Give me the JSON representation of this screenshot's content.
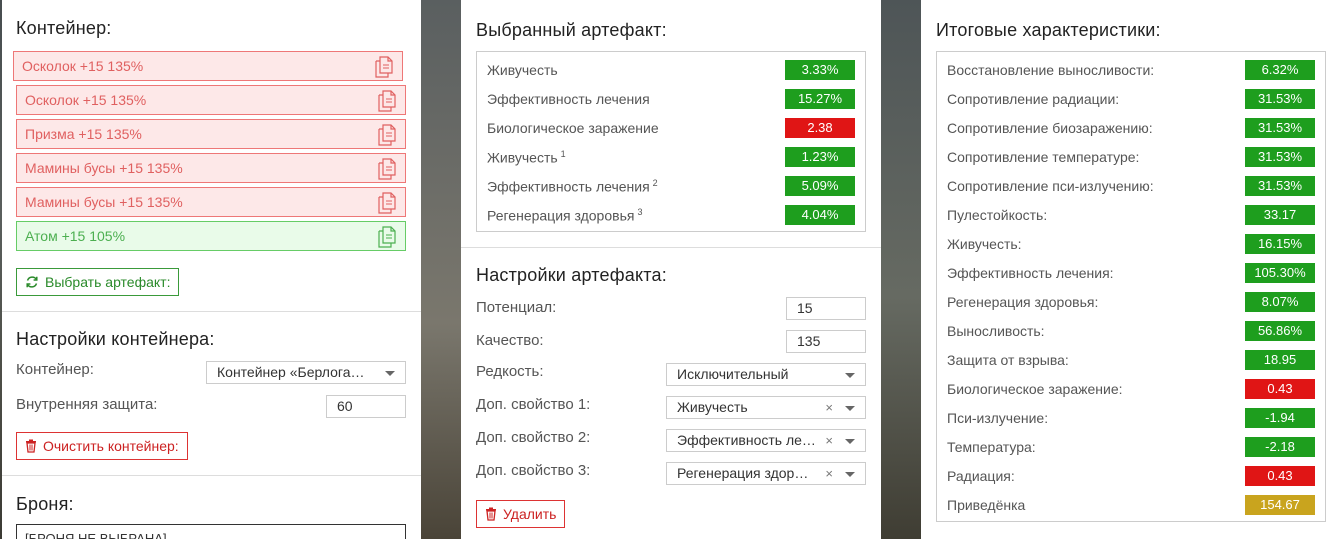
{
  "container_panel": {
    "title": "Контейнер:",
    "items": [
      {
        "label": "Осколок +15 135%",
        "state": "red"
      },
      {
        "label": "Осколок +15 135%",
        "state": "red"
      },
      {
        "label": "Призма +15 135%",
        "state": "red"
      },
      {
        "label": "Мамины бусы +15 135%",
        "state": "red"
      },
      {
        "label": "Мамины бусы +15 135%",
        "state": "red"
      },
      {
        "label": "Атом +15 105%",
        "state": "green"
      }
    ],
    "select_button": "Выбрать артефакт:"
  },
  "container_settings": {
    "title": "Настройки контейнера:",
    "container_label": "Контейнер:",
    "container_value": "Контейнер «Берлога…",
    "inner_protection_label": "Внутренняя защита:",
    "inner_protection_value": "60",
    "clear_button": "Очистить контейнер:"
  },
  "armor": {
    "title": "Броня:",
    "value": "[БРОНЯ НЕ ВЫБРАНА]"
  },
  "selected_artifact": {
    "title": "Выбранный артефакт:",
    "stats": [
      {
        "name": "Живучесть",
        "sup": "",
        "value": "3.33%",
        "color": "green"
      },
      {
        "name": "Эффективность лечения",
        "sup": "",
        "value": "15.27%",
        "color": "green"
      },
      {
        "name": "Биологическое заражение",
        "sup": "",
        "value": "2.38",
        "color": "red"
      },
      {
        "name": "Живучесть",
        "sup": "1",
        "value": "1.23%",
        "color": "green"
      },
      {
        "name": "Эффективность лечения",
        "sup": "2",
        "value": "5.09%",
        "color": "green"
      },
      {
        "name": "Регенерация здоровья",
        "sup": "3",
        "value": "4.04%",
        "color": "green"
      }
    ]
  },
  "artifact_settings": {
    "title": "Настройки артефакта:",
    "potential_label": "Потенциал:",
    "potential_value": "15",
    "quality_label": "Качество:",
    "quality_value": "135",
    "rarity_label": "Редкость:",
    "rarity_value": "Исключительный",
    "extra1_label": "Доп. свойство 1:",
    "extra1_value": "Живучесть",
    "extra2_label": "Доп. свойство 2:",
    "extra2_value": "Эффективность ле…",
    "extra3_label": "Доп. свойство 3:",
    "extra3_value": "Регенерация здор…",
    "clear_x": "×",
    "delete_button": "Удалить"
  },
  "total_stats": {
    "title": "Итоговые характеристики:",
    "stats": [
      {
        "name": "Восстановление выносливости:",
        "value": "6.32%",
        "color": "green"
      },
      {
        "name": "Сопротивление радиации:",
        "value": "31.53%",
        "color": "green"
      },
      {
        "name": "Сопротивление биозаражению:",
        "value": "31.53%",
        "color": "green"
      },
      {
        "name": "Сопротивление температуре:",
        "value": "31.53%",
        "color": "green"
      },
      {
        "name": "Сопротивление пси-излучению:",
        "value": "31.53%",
        "color": "green"
      },
      {
        "name": "Пулестойкость:",
        "value": "33.17",
        "color": "green"
      },
      {
        "name": "Живучесть:",
        "value": "16.15%",
        "color": "green"
      },
      {
        "name": "Эффективность лечения:",
        "value": "105.30%",
        "color": "green"
      },
      {
        "name": "Регенерация здоровья:",
        "value": "8.07%",
        "color": "green"
      },
      {
        "name": "Выносливость:",
        "value": "56.86%",
        "color": "green"
      },
      {
        "name": "Защита от взрыва:",
        "value": "18.95",
        "color": "green"
      },
      {
        "name": "Биологическое заражение:",
        "value": "0.43",
        "color": "red"
      },
      {
        "name": "Пси-излучение:",
        "value": "-1.94",
        "color": "green"
      },
      {
        "name": "Температура:",
        "value": "-2.18",
        "color": "green"
      },
      {
        "name": "Радиация:",
        "value": "0.43",
        "color": "red"
      },
      {
        "name": "Приведёнка",
        "value": "154.67",
        "color": "gold"
      }
    ]
  },
  "colors": {
    "positive": "#1e9e1e",
    "negative": "#e01515",
    "summary": "#c9a41e"
  }
}
